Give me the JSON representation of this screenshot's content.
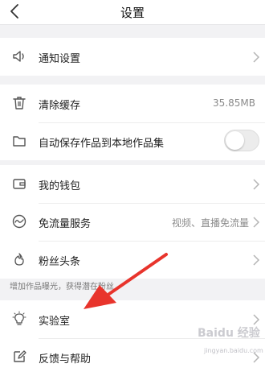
{
  "header": {
    "title": "设置"
  },
  "sections": {
    "notify": {
      "label": "通知设置"
    },
    "clear_cache": {
      "label": "清除缓存",
      "value": "35.85MB"
    },
    "auto_save": {
      "label": "自动保存作品到本地作品集",
      "enabled": false
    },
    "wallet": {
      "label": "我的钱包"
    },
    "free_traffic": {
      "label": "免流量服务",
      "value": "视频、直播免流量"
    },
    "fans_headline": {
      "label": "粉丝头条"
    },
    "tip": "增加作品曝光，获得潜在粉丝",
    "lab": {
      "label": "实验室"
    },
    "feedback": {
      "label": "反馈与帮助"
    }
  },
  "watermark": {
    "text": "Baidu 经验",
    "sub": "jingyan.baidu.com"
  },
  "colors": {
    "annotation_arrow": "#e8342c",
    "background": "#f2f2f4",
    "toggle_off": "#ececec"
  }
}
